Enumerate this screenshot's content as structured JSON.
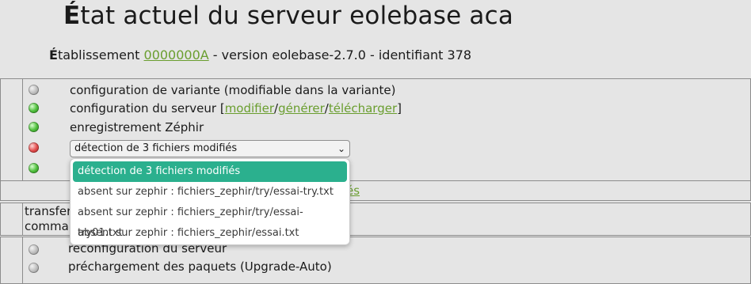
{
  "header": {
    "title_first": "É",
    "title_rest": "tat actuel du serveur eolebase aca",
    "sub_first": "É",
    "sub_rest": "tablissement ",
    "etab_link": "0000000A",
    "sub_after": " - version eolebase-2.7.0 - identifiant 378"
  },
  "status": {
    "variante_label": "configuration de variante  (modifiable dans la variante)",
    "serveur_label": "configuration du serveur  [",
    "serveur_link_modifier": "modifier",
    "sep1": "/",
    "serveur_link_generer": "générer",
    "sep2": "/",
    "serveur_link_telecharger": "télécharger",
    "serveur_close": "]",
    "zephir_label": "enregistrement Zéphir",
    "select_value": "détection de 3 fichiers modifiés"
  },
  "dropdown": {
    "options": [
      "détection de 3 fichiers modifiés",
      "absent sur zephir : fichiers_zephir/try/essai-try.txt",
      "absent sur zephir : fichiers_zephir/try/essai-try01.txt",
      "absent sur zephir : fichiers_zephir/essai.txt"
    ]
  },
  "partial": {
    "link_tail": "és",
    "transfer_frag": "transfer",
    "command_frag": "comman"
  },
  "actions": {
    "reconfig_label": "reconfiguration du serveur",
    "prechargement_label": "préchargement des paquets (Upgrade-Auto)"
  },
  "colors": {
    "accent": "#2bb08e",
    "link": "#6a9e2f",
    "led_green": "#4fbf3c",
    "led_red": "#e24d4d"
  }
}
